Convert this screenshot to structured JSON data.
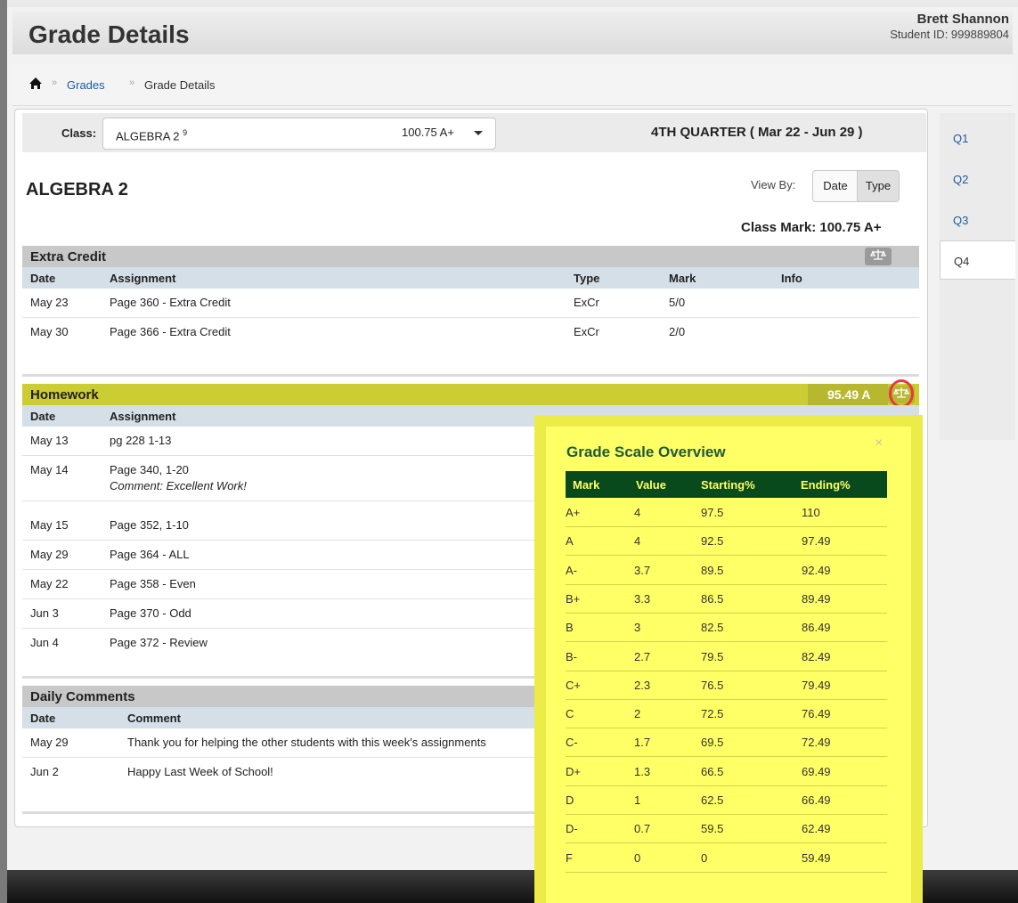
{
  "header": {
    "title": "Grade Details",
    "student_name": "Brett Shannon",
    "student_id": "Student ID: 999889804"
  },
  "breadcrumb": {
    "home_icon": "home-icon",
    "separator": "»",
    "link": "Grades",
    "current": "Grade Details"
  },
  "class_bar": {
    "label": "Class:",
    "selected_class": "ALGEBRA 2",
    "selected_superscript": "9",
    "selected_mark": "100.75 A+",
    "quarter": "4TH QUARTER ( Mar 22 - Jun 29 )"
  },
  "class_title": "ALGEBRA 2",
  "view_by": {
    "label": "View By:",
    "options": [
      "Date",
      "Type"
    ],
    "selected": "Type"
  },
  "class_mark": "Class Mark: 100.75 A+",
  "extra_credit": {
    "title": "Extra Credit",
    "columns": [
      "Date",
      "Assignment",
      "Type",
      "Mark",
      "Info"
    ],
    "rows": [
      {
        "date": "May 23",
        "assignment": "Page 360 - Extra Credit",
        "type": "ExCr",
        "mark": "5/0"
      },
      {
        "date": "May 30",
        "assignment": "Page 366 - Extra Credit",
        "type": "ExCr",
        "mark": "2/0"
      }
    ]
  },
  "homework": {
    "title": "Homework",
    "mark": "95.49 A",
    "columns": [
      "Date",
      "Assignment"
    ],
    "rows": [
      {
        "date": "May 13",
        "assignment": "pg 228 1-13"
      },
      {
        "date": "May 14",
        "assignment": "Page 340, 1-20",
        "comment": "Comment: Excellent Work!"
      },
      {
        "date": "May 15",
        "assignment": "Page 352, 1-10"
      },
      {
        "date": "May 29",
        "assignment": "Page 364 - ALL"
      },
      {
        "date": "May 22",
        "assignment": "Page 358 - Even"
      },
      {
        "date": "Jun 3",
        "assignment": "Page 370 - Odd"
      },
      {
        "date": "Jun 4",
        "assignment": "Page 372 - Review"
      }
    ]
  },
  "daily_comments": {
    "title": "Daily Comments",
    "columns": [
      "Date",
      "Comment"
    ],
    "rows": [
      {
        "date": "May 29",
        "comment": "Thank you for helping the other students with this week's assignments"
      },
      {
        "date": "Jun 2",
        "comment": "Happy Last Week of School!"
      }
    ]
  },
  "quarter_tabs": [
    "Q1",
    "Q2",
    "Q3",
    "Q4"
  ],
  "active_quarter": "Q4",
  "grade_scale": {
    "title": "Grade Scale Overview",
    "close": "×",
    "columns": [
      "Mark",
      "Value",
      "Starting%",
      "Ending%"
    ],
    "rows": [
      [
        "A+",
        "4",
        "97.5",
        "110"
      ],
      [
        "A",
        "4",
        "92.5",
        "97.49"
      ],
      [
        "A-",
        "3.7",
        "89.5",
        "92.49"
      ],
      [
        "B+",
        "3.3",
        "86.5",
        "89.49"
      ],
      [
        "B",
        "3",
        "82.5",
        "86.49"
      ],
      [
        "B-",
        "2.7",
        "79.5",
        "82.49"
      ],
      [
        "C+",
        "2.3",
        "76.5",
        "79.49"
      ],
      [
        "C",
        "2",
        "72.5",
        "76.49"
      ],
      [
        "C-",
        "1.7",
        "69.5",
        "72.49"
      ],
      [
        "D+",
        "1.3",
        "66.5",
        "69.49"
      ],
      [
        "D",
        "1",
        "62.5",
        "66.49"
      ],
      [
        "D-",
        "0.7",
        "59.5",
        "62.49"
      ],
      [
        "F",
        "0",
        "0",
        "59.49"
      ]
    ]
  },
  "colors": {
    "homework_bar": "#cccc33",
    "popup_bg": "#ffff66",
    "popup_header": "#094a1d",
    "highlight_circle": "#e8383d",
    "link": "#1a5c9c"
  }
}
